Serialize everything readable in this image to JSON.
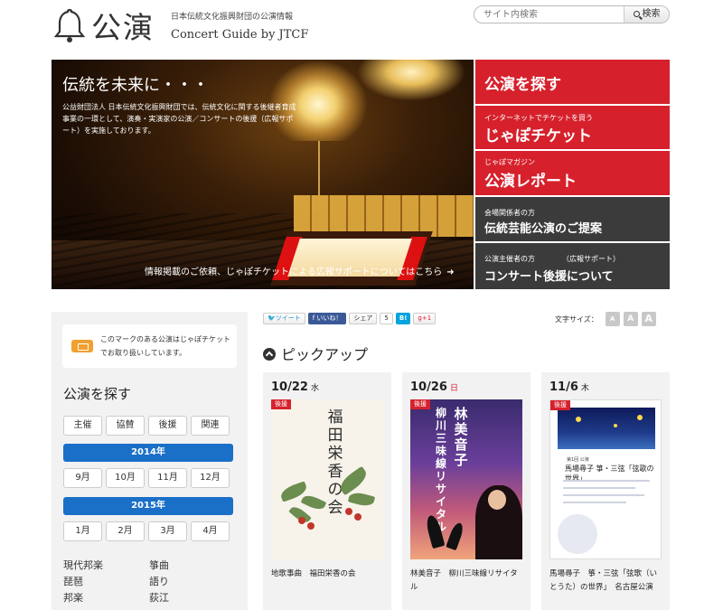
{
  "header": {
    "logo_title": "公演",
    "logo_sub1": "日本伝統文化振興財団の公演情報",
    "logo_sub2": "Concert Guide by JTCF",
    "search_placeholder": "サイト内検索",
    "search_button": "検索",
    "search_icon": "magnifier-icon"
  },
  "hero": {
    "title": "伝統を未来に・・・",
    "text": "公益財団法人 日本伝統文化振興財団では、伝統文化に関する後継者育成事業の一環として、演奏・実演家の公演／コンサートの後援（広報サポート）を実施しております。",
    "link": "情報掲載のご依頼、じゃぽチケットによる広報サポートについてはこちら",
    "link_arrow": "➜"
  },
  "right_nav": {
    "item1": {
      "big": "公演を探す"
    },
    "item2": {
      "small": "インターネットでチケットを買う",
      "big": "じゃぽチケット"
    },
    "item3": {
      "small": "じゃぽマガジン",
      "big": "公演レポート"
    },
    "item4": {
      "small": "会場関係者の方",
      "big": "伝統芸能公演のご提案"
    },
    "item5": {
      "small": "公演主催者の方",
      "small2": "（広報サポート）",
      "big": "コンサート後援について"
    }
  },
  "sidebar": {
    "notice": "このマークのある公演はじゃぽチケットでお取り扱いしています。",
    "title": "公演を探す",
    "filters": [
      "主催",
      "協賛",
      "後援",
      "関連"
    ],
    "year1": "2014年",
    "months1": [
      "9月",
      "10月",
      "11月",
      "12月"
    ],
    "year2": "2015年",
    "months2": [
      "1月",
      "2月",
      "3月",
      "4月"
    ],
    "genres_left": [
      "現代邦楽",
      "琵琶",
      "邦楽"
    ],
    "genres_right": [
      "箏曲",
      "語り",
      "荻江"
    ]
  },
  "share": {
    "tweet": "ツイート",
    "like": "いいね！",
    "share": "シェア",
    "share_count": "5",
    "hatena": "B!",
    "gplus": "g+1"
  },
  "fontsize": {
    "label": "文字サイズ：",
    "small": "A",
    "medium": "A",
    "large": "A"
  },
  "pickup": {
    "title": "ピックアップ"
  },
  "cards": [
    {
      "date": "10/22",
      "dow": "水",
      "tag": "後援",
      "title": "地歌事曲　福田栄香の会",
      "poster_text": "福田栄香の会"
    },
    {
      "date": "10/26",
      "dow": "日",
      "tag": "後援",
      "title": "林美音子　柳川三味線リサイタル",
      "poster_name": "林美音子",
      "poster_sub": "柳川三味線リサイタル"
    },
    {
      "date": "11/6",
      "dow": "木",
      "tag": "後援",
      "title": "馬場尋子　箏・三弦「弦歌（いとうた）の世界」　名古屋公演",
      "poster_t1": "第1回 公演",
      "poster_t2": "馬場尋子 箏・三弦「弦歌の世界」"
    }
  ],
  "colors": {
    "red": "#d6212c",
    "dark": "#3b3b3b",
    "blue": "#1a6fc7"
  }
}
